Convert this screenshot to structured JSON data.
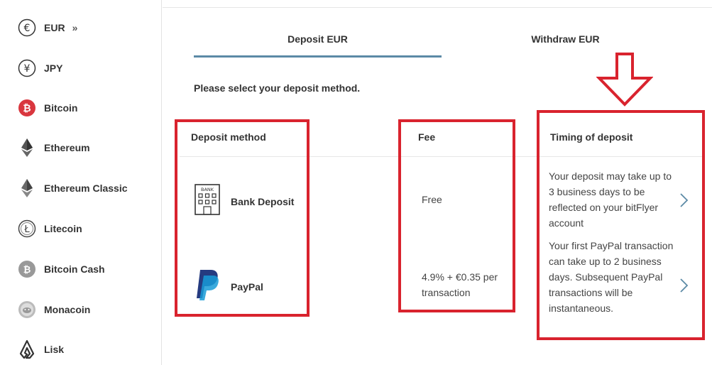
{
  "sidebar": {
    "items": [
      {
        "label": "EUR",
        "icon": "euro-icon",
        "active": true
      },
      {
        "label": "JPY",
        "icon": "yen-icon"
      },
      {
        "label": "Bitcoin",
        "icon": "bitcoin-icon"
      },
      {
        "label": "Ethereum",
        "icon": "ethereum-icon"
      },
      {
        "label": "Ethereum Classic",
        "icon": "ethereum-classic-icon"
      },
      {
        "label": "Litecoin",
        "icon": "litecoin-icon"
      },
      {
        "label": "Bitcoin Cash",
        "icon": "bitcoin-cash-icon"
      },
      {
        "label": "Monacoin",
        "icon": "monacoin-icon"
      },
      {
        "label": "Lisk",
        "icon": "lisk-icon"
      }
    ],
    "active_indicator": "»"
  },
  "tabs": [
    {
      "label": "Deposit EUR",
      "active": true
    },
    {
      "label": "Withdraw EUR",
      "active": false
    }
  ],
  "prompt": "Please select your deposit method.",
  "table": {
    "headers": {
      "method": "Deposit method",
      "fee": "Fee",
      "timing": "Timing of deposit"
    },
    "rows": [
      {
        "method": "Bank Deposit",
        "icon": "bank-building-icon",
        "icon_text": "BANK",
        "fee": "Free",
        "timing": "Your deposit may take up to 3 business days to be reflected on your bitFlyer account"
      },
      {
        "method": "PayPal",
        "icon": "paypal-icon",
        "fee": "4.9% + €0.35 per transaction",
        "timing": "Your first PayPal transaction can take up to 2 business days. Subsequent PayPal transactions will be instantaneous."
      }
    ]
  },
  "colors": {
    "accent": "#5b8aa6",
    "annotation": "#d9232e",
    "bitcoin": "#d9363e"
  }
}
